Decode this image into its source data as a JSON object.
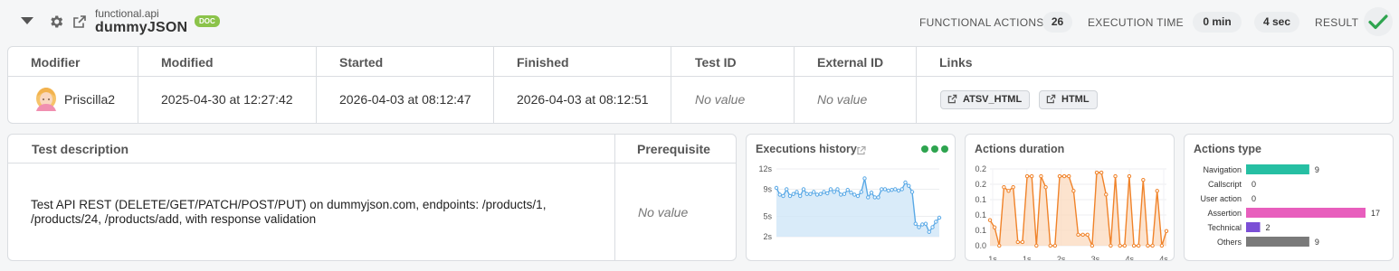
{
  "header": {
    "subtitle": "functional.api",
    "title": "dummyJSON",
    "badge": "DOC",
    "functional_actions_label": "FUNCTIONAL ACTIONS",
    "functional_actions_value": "26",
    "execution_time_label": "EXECUTION TIME",
    "execution_min": "0 min",
    "execution_sec": "4 sec",
    "result_label": "RESULT"
  },
  "info": {
    "headers": [
      "Modifier",
      "Modified",
      "Started",
      "Finished",
      "Test ID",
      "External ID",
      "Links"
    ],
    "modifier": "Priscilla2",
    "modified": "2025-04-30 at 12:27:42",
    "started": "2026-04-03 at 08:12:47",
    "finished": "2026-04-03 at 08:12:51",
    "test_id": "No value",
    "external_id": "No value",
    "links": [
      "ATSV_HTML",
      "HTML"
    ]
  },
  "description": {
    "header": "Test description",
    "prereq_header": "Prerequisite",
    "text": "Test API REST (DELETE/GET/PATCH/POST/PUT) on dummyjson.com, endpoints: /products/1, /products/24, /products/add, with response validation",
    "prereq_value": "No value"
  },
  "colors": {
    "history_line": "#5aa9e6",
    "duration_line": "#f0832a",
    "navigation": "#26bfa3",
    "assertion": "#e85ebd",
    "technical": "#7b4fd6",
    "others": "#7a7a7a",
    "success": "#2ea44f"
  },
  "chart_data": [
    {
      "type": "area",
      "title": "Executions history",
      "y_ticks": [
        "12s",
        "9s",
        "5s",
        "2s"
      ],
      "ylim": [
        2,
        12
      ],
      "values": [
        9.2,
        8.2,
        8.0,
        9.0,
        8.0,
        8.3,
        8.6,
        8.0,
        9.0,
        8.3,
        8.3,
        8.6,
        8.2,
        8.3,
        8.6,
        8.4,
        9.0,
        8.6,
        9.0,
        8.2,
        8.3,
        8.9,
        8.5,
        8.2,
        8.0,
        8.6,
        10.6,
        7.8,
        8.5,
        7.8,
        7.8,
        9.0,
        9.0,
        8.8,
        8.9,
        9.0,
        8.8,
        9.0,
        10.0,
        9.5,
        8.6,
        3.9,
        3.4,
        3.8,
        3.9,
        2.7,
        3.4,
        4.2,
        4.8
      ]
    },
    {
      "type": "area",
      "title": "Actions duration",
      "y_ticks": [
        "0.2",
        "0.2",
        "0.1",
        "0.1",
        "0.1",
        "0.0"
      ],
      "x_ticks": [
        "1s",
        "1s",
        "2s",
        "3s",
        "4s",
        "4s"
      ],
      "ylim": [
        0,
        0.21
      ],
      "values": [
        0.07,
        0.05,
        0.0,
        0.16,
        0.15,
        0.16,
        0.01,
        0.01,
        0.19,
        0.19,
        0.0,
        0.19,
        0.16,
        0.0,
        0.0,
        0.19,
        0.19,
        0.19,
        0.15,
        0.03,
        0.03,
        0.03,
        0.0,
        0.2,
        0.2,
        0.14,
        0.0,
        0.19,
        0.0,
        0.0,
        0.19,
        0.0,
        0.0,
        0.18,
        0.0,
        0.0,
        0.15,
        0.0,
        0.04
      ]
    },
    {
      "type": "bar",
      "title": "Actions type",
      "categories": [
        "Navigation",
        "Callscript",
        "User action",
        "Assertion",
        "Technical",
        "Others"
      ],
      "values": [
        9,
        0,
        0,
        17,
        2,
        9
      ]
    }
  ]
}
